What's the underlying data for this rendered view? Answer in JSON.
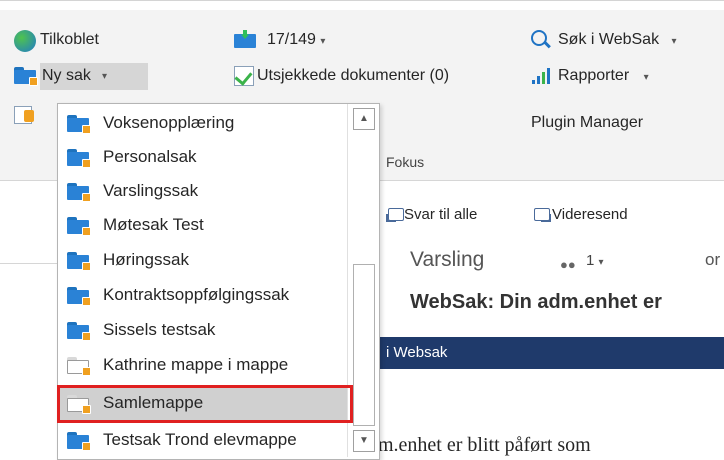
{
  "ribbon": {
    "connected_label": "Tilkoblet",
    "inbox_count": "17/149",
    "new_case_label": "Ny sak",
    "checked_out_label": "Utsjekkede dokumenter (0)",
    "search_label": "Søk i WebSak",
    "reports_label": "Rapporter",
    "plugin_manager_label": "Plugin Manager",
    "focus_label": "Fokus"
  },
  "menu": {
    "items": [
      {
        "label": "Voksenopplæring",
        "icon": "case-folder-icon"
      },
      {
        "label": "Personalsak",
        "icon": "case-folder-icon"
      },
      {
        "label": "Varslingssak",
        "icon": "case-folder-icon"
      },
      {
        "label": "Møtesak Test",
        "icon": "case-folder-icon"
      },
      {
        "label": "Høringssak",
        "icon": "case-folder-icon"
      },
      {
        "label": "Kontraktsoppfølgingssak",
        "icon": "case-folder-icon"
      },
      {
        "label": "Sissels testsak",
        "icon": "case-folder-icon"
      },
      {
        "label": "Kathrine mappe i mappe",
        "icon": "folder-icon"
      },
      {
        "label": "Samlemappe",
        "icon": "folder-icon"
      },
      {
        "label": "Testsak Trond elevmappe",
        "icon": "case-folder-icon"
      }
    ],
    "selected_index": 8,
    "scroll_up": "▲",
    "scroll_down": "▼"
  },
  "mail": {
    "reply_all_label": "Svar til alle",
    "forward_label": "Videresend",
    "subject_short": "Varsling",
    "people_count": "1",
    "partial_or": "or",
    "subject": "WebSak: Din adm.enhet er",
    "banner_text": "i Websak",
    "body_text": "m.enhet er blitt påført som"
  },
  "colors": {
    "accent": "#2a82d6",
    "highlight": "#e02020",
    "banner": "#1f3a6b"
  }
}
